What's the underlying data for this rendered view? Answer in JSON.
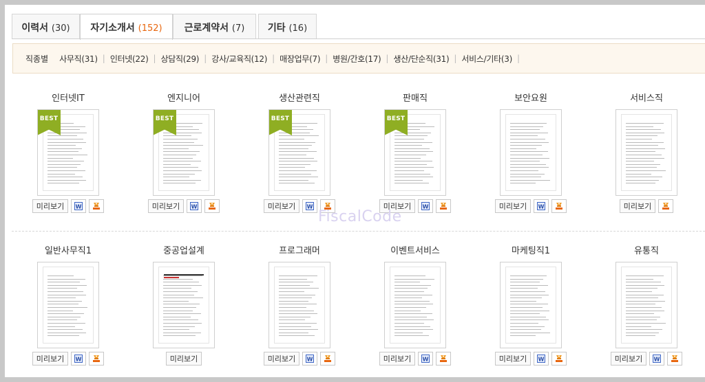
{
  "tabs": [
    {
      "label": "이력서",
      "count": "(30)"
    },
    {
      "label": "자기소개서",
      "count": "(152)"
    },
    {
      "label": "근로계약서",
      "count": "(7)"
    },
    {
      "label": "기타",
      "count": "(16)"
    }
  ],
  "filter": {
    "label": "직종별",
    "items": [
      "사무직(31)",
      "인터넷(22)",
      "상담직(29)",
      "강사/교육직(12)",
      "매장업무(7)",
      "병원/간호(17)",
      "생산/단순직(31)",
      "서비스/기타(3)"
    ]
  },
  "badge": "BEST",
  "preview_label": "미리보기",
  "watermark": "FiscalCode",
  "row1": [
    {
      "title": "인터넷IT",
      "best": true
    },
    {
      "title": "엔지니어",
      "best": true
    },
    {
      "title": "생산관련직",
      "best": true
    },
    {
      "title": "판매직",
      "best": true
    },
    {
      "title": "보안요원",
      "best": false
    },
    {
      "title": "서비스직",
      "best": false
    }
  ],
  "row2": [
    {
      "title": "일반사무직1",
      "best": false
    },
    {
      "title": "중공업설계",
      "best": false
    },
    {
      "title": "프로그래머",
      "best": false
    },
    {
      "title": "이벤트서비스",
      "best": false
    },
    {
      "title": "마케팅직1",
      "best": false
    },
    {
      "title": "유통직",
      "best": false
    }
  ],
  "colors": {
    "accent": "#e8660e",
    "best_ribbon": "#8fae23",
    "filter_bg": "#fdf7ee"
  }
}
